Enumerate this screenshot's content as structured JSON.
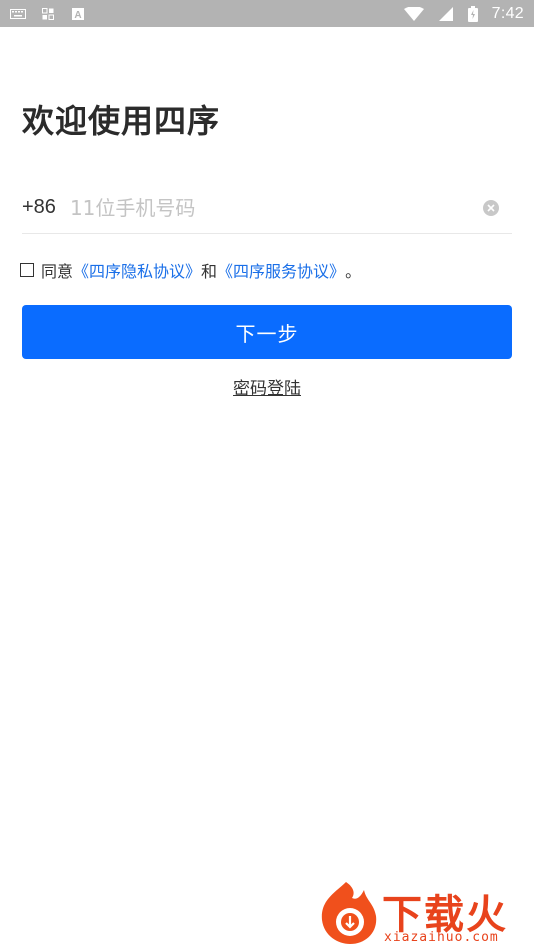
{
  "status_bar": {
    "time": "7:42",
    "left_icons": [
      "keyboard-icon",
      "qr-grid-icon",
      "a-box-icon"
    ],
    "right_icons": [
      "wifi-icon",
      "signal-icon",
      "battery-icon"
    ]
  },
  "page": {
    "title": "欢迎使用四序"
  },
  "phone": {
    "country_code": "+86",
    "placeholder": "11位手机号码",
    "value": ""
  },
  "agreement": {
    "prefix": "同意",
    "privacy_link": "《四序隐私协议》",
    "conjunction": "和",
    "service_link": "《四序服务协议》",
    "suffix": "。",
    "checked": false
  },
  "actions": {
    "next_label": "下一步",
    "password_login_label": "密码登陆"
  },
  "watermark": {
    "text": "下载火",
    "subtext": "xiazaihuo.com"
  },
  "colors": {
    "primary": "#0a6cff",
    "link": "#1a6fe8",
    "status_bar": "#b3b3b3",
    "watermark": "#e8431c"
  }
}
